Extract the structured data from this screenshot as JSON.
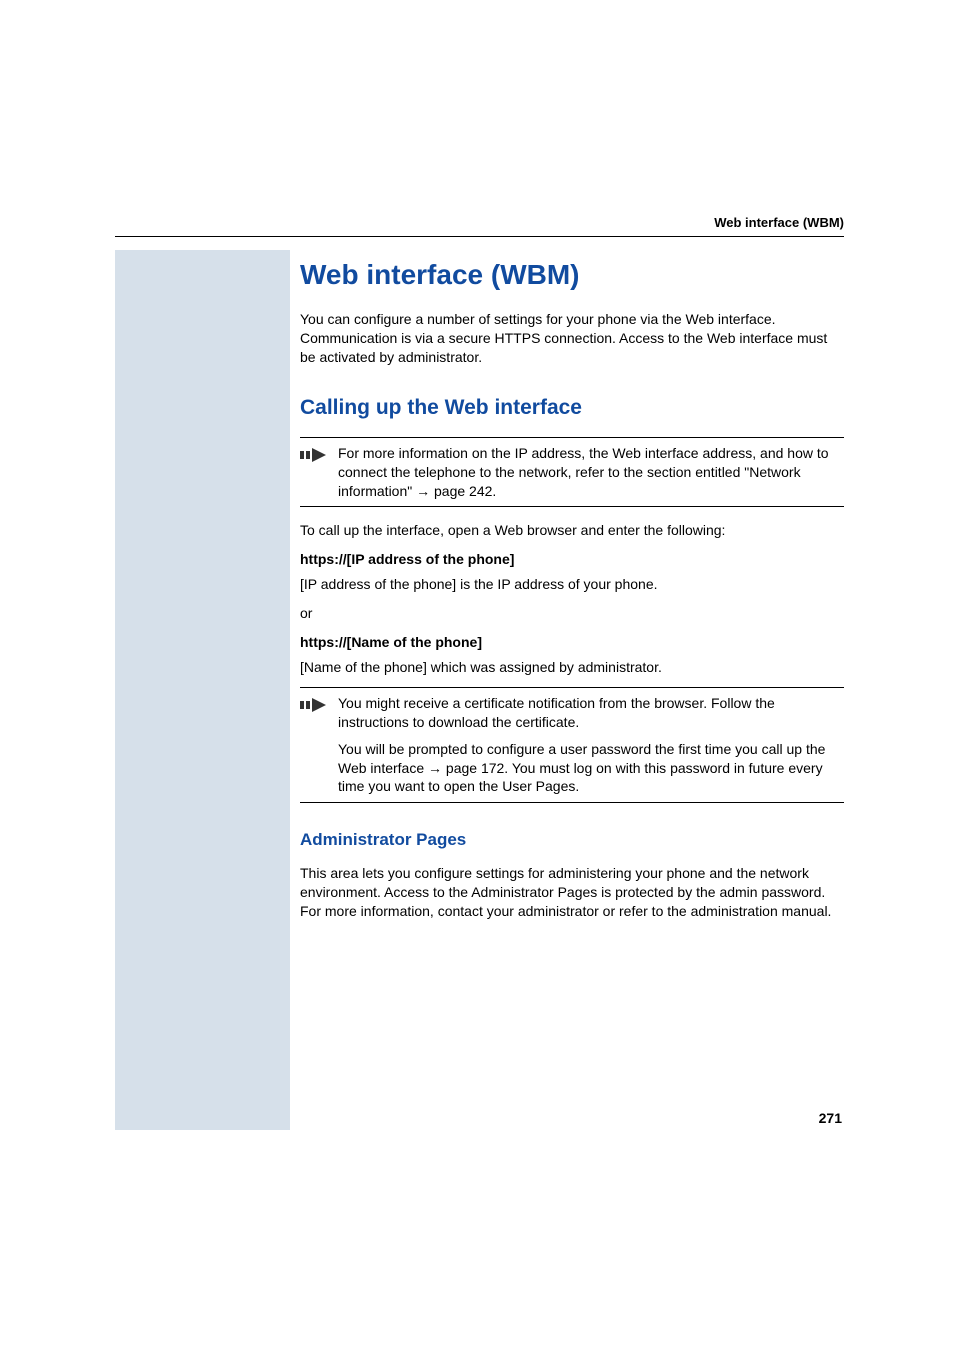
{
  "header": "Web interface (WBM)",
  "title": "Web interface (WBM)",
  "intro": "You can configure a number of settings for your phone via the Web interface. Communication is via a secure HTTPS connection. Access to the Web interface must be activated by administrator.",
  "section1": {
    "heading": "Calling up the Web interface",
    "note1_part1": "For more information on the IP address, the Web interface address, and how to connect the telephone to the network, refer to the section entitled \"Network information\" ",
    "note1_arrow": "→",
    "note1_part2": " page 242.",
    "p1": "To call up the interface, open a Web browser and enter the following:",
    "b1": "https://[IP address of the phone]",
    "p2": "[IP address of the phone] is the IP address of your phone.",
    "or": "or",
    "b2": "https://[Name of the phone]",
    "p3": "[Name of the phone] which was assigned by administrator.",
    "note2_p1": "You might receive a certificate notification from the browser. Follow the instructions to download the certificate.",
    "note2_p2_a": "You will be prompted to configure a user password the first time you call up the Web interface ",
    "note2_arrow": "→",
    "note2_p2_b": " page 172. You must log on with this password in future every time you want to open the User Pages."
  },
  "section2": {
    "heading": "Administrator Pages",
    "p1": "This area lets you configure settings for administering your phone and the network environment. Access to the Administrator Pages is protected by the admin password. For more information, contact your administrator or refer to the administration manual."
  },
  "pageNumber": "271"
}
